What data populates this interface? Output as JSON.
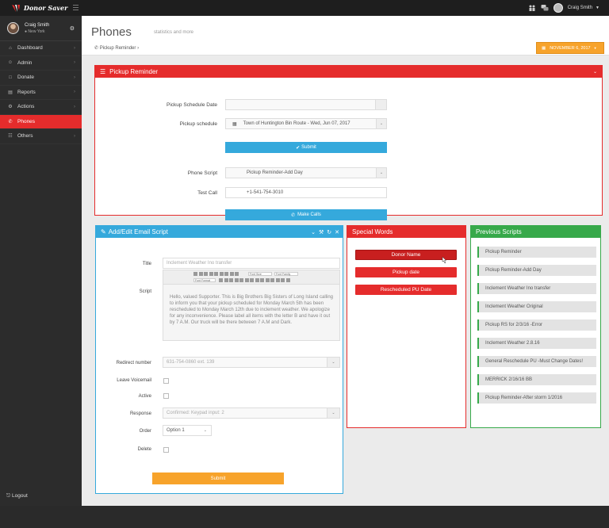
{
  "app": {
    "name": "Donor Saver"
  },
  "header": {
    "user_name": "Craig Smith"
  },
  "sidebar": {
    "user_name": "Craig Smith",
    "user_location": "New York",
    "items": [
      {
        "label": "Dashboard",
        "icon": "home-icon"
      },
      {
        "label": "Admin",
        "icon": "user-icon"
      },
      {
        "label": "Donate",
        "icon": "bookmark-icon"
      },
      {
        "label": "Reports",
        "icon": "file-icon"
      },
      {
        "label": "Actions",
        "icon": "cogs-icon"
      },
      {
        "label": "Phones",
        "icon": "phone-icon"
      },
      {
        "label": "Others",
        "icon": "sitemap-icon"
      }
    ],
    "logout": "Logout"
  },
  "page": {
    "title": "Phones",
    "subtitle": "statistics and more",
    "breadcrumb": "Pickup Reminder",
    "date_button": "NOVEMBER 6, 2017"
  },
  "pickup": {
    "title": "Pickup Reminder",
    "schedule_date_label": "Pickup Schedule Date",
    "schedule_date_value": "",
    "schedule_label": "Pickup schedule",
    "schedule_value": "Town of Huntington Bin Route - Wed, Jun 07, 2017",
    "submit_label": "Submit",
    "script_label": "Phone Script",
    "script_value": "Pickup Reminder-Add Day",
    "test_call_label": "Test Call",
    "test_call_value": "+1-541-754-3010",
    "make_calls_label": "Make Calls"
  },
  "email": {
    "title": "Add/Edit Email Script",
    "title_label": "Title",
    "title_value": "Inclement Weather Ino transfer",
    "script_label": "Script",
    "toolbar_font_size": "Font Size",
    "toolbar_font_family": "Font Family",
    "toolbar_format": "Font Format",
    "script_body": "Hello, valued Supporter. This is Big Brothers Big Sisters of Long Island calling to inform you that your pickup scheduled for Monday March 5th has been rescheduled to Monday March 12th due to inclement weather. We apologize for any inconvenience. Please label all items with the letter B and have it out by 7 A.M. Our truck will be there between 7 A.M and Dark.",
    "redirect_label": "Redirect number",
    "redirect_value": "631-754-0860 ext. 139",
    "voicemail_label": "Leave Voicemail",
    "active_label": "Active",
    "response_label": "Response",
    "response_value": "Confirmed: Keypad input: 2",
    "order_label": "Order",
    "order_value": "Option 1",
    "delete_label": "Delete",
    "submit_label": "Submit"
  },
  "special_words": {
    "title": "Special Words",
    "items": [
      "Donor Name",
      "Pickup date",
      "Rescheduled PU Date"
    ]
  },
  "previous_scripts": {
    "title": "Previous Scripts",
    "items": [
      "Pickup Reminder",
      "Pickup Reminder-Add Day",
      "Inclement Weather Ino transfer",
      "Inclement Weather Original",
      "Pickup RS for 2/3/16 -Error",
      "Inclement Weather 2.8.16",
      "General Reschedule PU -Must Change Dates!",
      "MERRICK 2/16/16 BB",
      "Pickup Reminder-After storm 1/2016"
    ]
  }
}
